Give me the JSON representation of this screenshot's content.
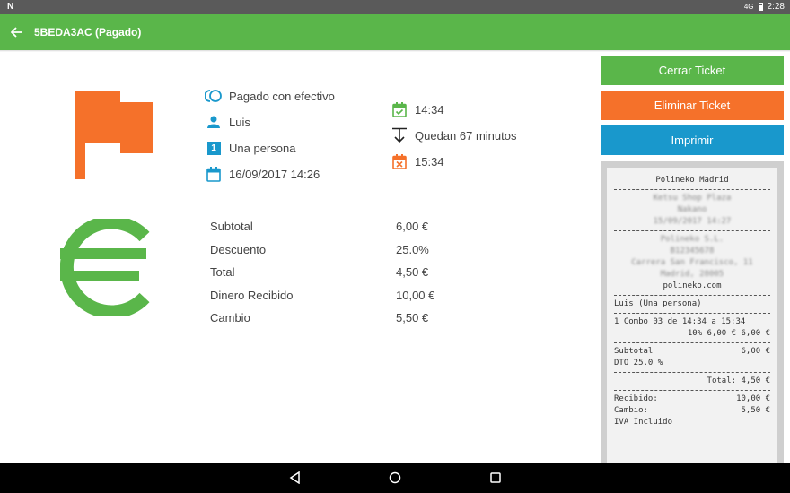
{
  "status_bar": {
    "carrier_glyph": "N",
    "signal": "4G",
    "time": "2:28"
  },
  "app_bar": {
    "title": "5BEDA3AC (Pagado)"
  },
  "colors": {
    "green": "#5ab64a",
    "orange": "#f5712a",
    "blue": "#1998cc"
  },
  "info": {
    "payment": "Pagado con efectivo",
    "customer": "Luis",
    "people": "Una persona",
    "people_icon_number": "1",
    "date": "16/09/2017 14:26",
    "start_time": "14:34",
    "remaining": "Quedan 67 minutos",
    "end_time": "15:34"
  },
  "summary": [
    {
      "label": "Subtotal",
      "value": "6,00 €"
    },
    {
      "label": "Descuento",
      "value": "25.0%"
    },
    {
      "label": "Total",
      "value": "4,50 €"
    },
    {
      "label": "Dinero Recibido",
      "value": "10,00 €"
    },
    {
      "label": "Cambio",
      "value": "5,50 €"
    }
  ],
  "buttons": {
    "close": "Cerrar Ticket",
    "delete": "Eliminar Ticket",
    "print": "Imprimir"
  },
  "ticket": {
    "shop_name": "Polineko Madrid",
    "blurred_1a": "Ketsu Shop Plaza",
    "blurred_1b": "Nakano",
    "blurred_1c": "15/09/2017 14:27",
    "blurred_2a": "Polineko S.L.",
    "blurred_2b": "B12345678",
    "blurred_2c": "Carrera San Francisco, 11",
    "blurred_2d": "Madrid, 28005",
    "website": "polineko.com",
    "customer_line": "Luis (Una persona)",
    "item_line": "1  Combo 03 de 14:34 a 15:34",
    "item_detail": "10%  6,00 €  6,00 €",
    "subtotal_label": "Subtotal",
    "subtotal_value": "6,00 €",
    "discount_line": "DTO 25.0 %",
    "total_line": "Total: 4,50 €",
    "received_label": "Recibido:",
    "received_value": "10,00 €",
    "change_label": "Cambio:",
    "change_value": "5,50 €",
    "vat_line": "IVA Incluido"
  }
}
